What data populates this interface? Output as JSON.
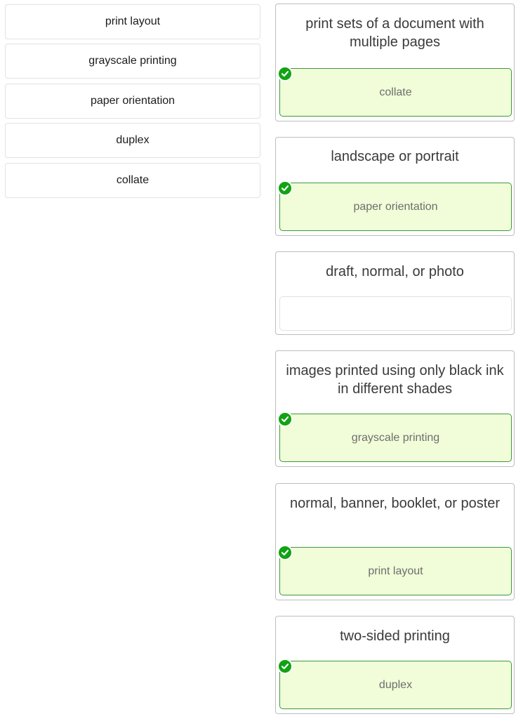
{
  "bank": {
    "items": [
      {
        "label": "print layout"
      },
      {
        "label": "grayscale printing"
      },
      {
        "label": "paper orientation"
      },
      {
        "label": "duplex"
      },
      {
        "label": "collate"
      }
    ]
  },
  "targets": [
    {
      "prompt": "print sets of a document with multiple pages",
      "answer": "collate",
      "state": "correct"
    },
    {
      "prompt": "landscape or portrait",
      "answer": "paper orientation",
      "state": "correct"
    },
    {
      "prompt": "draft, normal, or photo",
      "answer": "",
      "state": "empty"
    },
    {
      "prompt": "images printed using only black ink in different shades",
      "answer": "grayscale printing",
      "state": "correct"
    },
    {
      "prompt": "normal, banner, booklet, or poster",
      "answer": "print layout",
      "state": "correct"
    },
    {
      "prompt": "two-sided printing",
      "answer": "duplex",
      "state": "correct"
    }
  ],
  "colors": {
    "correct_fill": "#f1fcd8",
    "correct_border": "#3b9a3b",
    "check": "#11a313"
  },
  "icons": {
    "correct": "check-circle-icon"
  }
}
